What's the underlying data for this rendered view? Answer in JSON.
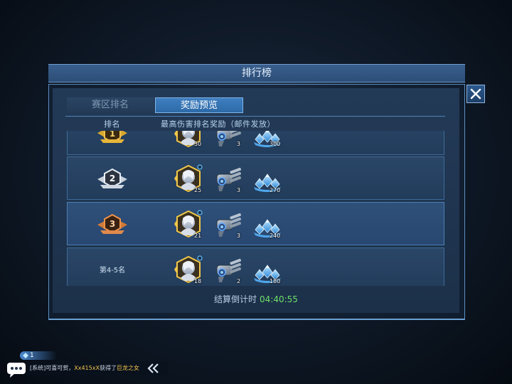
{
  "window": {
    "title": "排行榜"
  },
  "tabs": [
    {
      "label": "赛区排名",
      "active": false
    },
    {
      "label": "奖励预览",
      "active": true
    }
  ],
  "columns": {
    "rank": "排名",
    "reward": "最高伤害排名奖励（邮件发放）"
  },
  "rows": [
    {
      "rank_label": "1",
      "rank_icon": "gold-rank-badge-icon",
      "rewards": [
        {
          "icon": "character-card-icon",
          "qty": "30"
        },
        {
          "icon": "gatling-gun-icon",
          "qty": "3"
        },
        {
          "icon": "diamond-pile-icon",
          "qty": "300"
        }
      ]
    },
    {
      "rank_label": "2",
      "rank_icon": "silver-rank-badge-icon",
      "rewards": [
        {
          "icon": "character-card-icon",
          "qty": "25"
        },
        {
          "icon": "gatling-gun-icon",
          "qty": "3"
        },
        {
          "icon": "diamond-pile-icon",
          "qty": "270"
        }
      ]
    },
    {
      "rank_label": "3",
      "rank_icon": "bronze-rank-badge-icon",
      "rewards": [
        {
          "icon": "character-card-icon",
          "qty": "21"
        },
        {
          "icon": "gatling-gun-icon",
          "qty": "3"
        },
        {
          "icon": "diamond-pile-icon",
          "qty": "240"
        }
      ]
    },
    {
      "rank_label": "第4-5名",
      "rewards": [
        {
          "icon": "character-card-icon",
          "qty": "18"
        },
        {
          "icon": "gatling-gun-icon",
          "qty": "2"
        },
        {
          "icon": "diamond-pile-icon",
          "qty": "180"
        }
      ]
    }
  ],
  "countdown": {
    "label": "结算倒计时",
    "time": "04:40:55"
  },
  "chat": {
    "badge_count": "1",
    "prefix": "[系统]可喜可贺，",
    "player": "Xx415xX",
    "middle": "获得了",
    "item": "巨龙之女"
  },
  "colors": {
    "accent": "#3f7fc0",
    "timer": "#6ee06a",
    "highlight": "#f0c24a"
  }
}
